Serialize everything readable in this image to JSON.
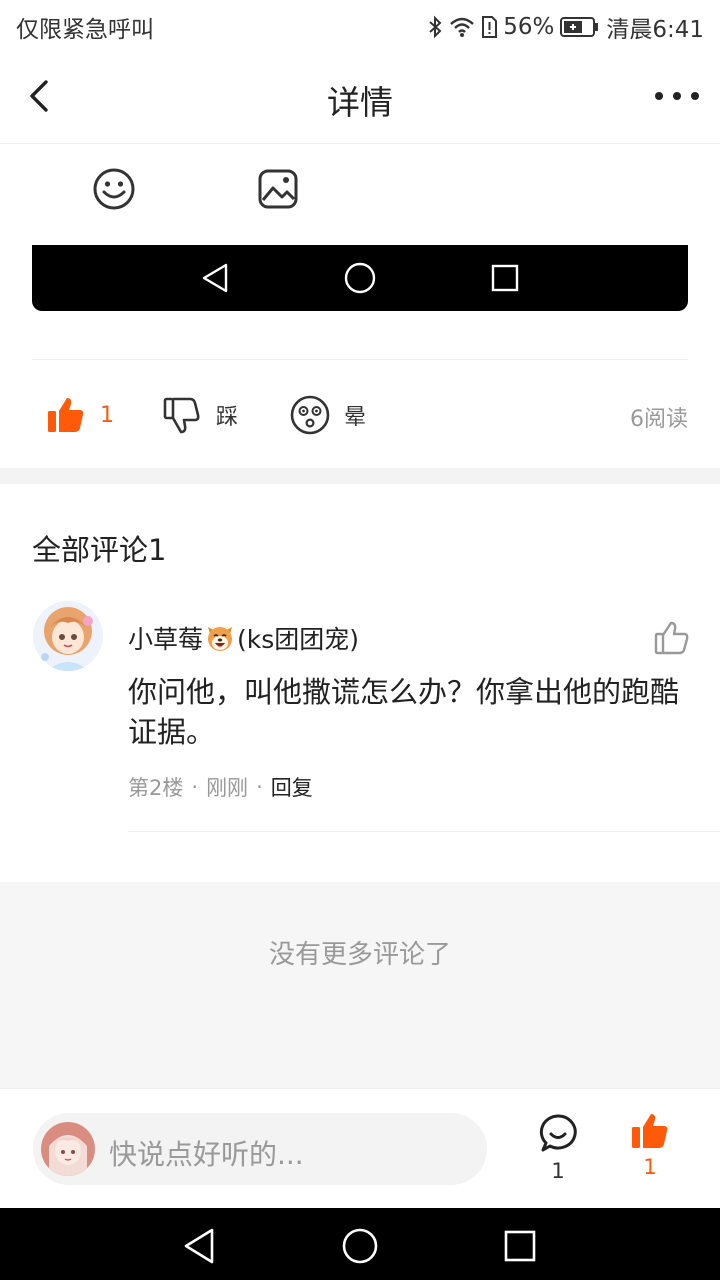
{
  "status_bar": {
    "carrier": "仅限紧急呼叫",
    "battery": "56%",
    "time": "清晨6:41"
  },
  "header": {
    "title": "详情"
  },
  "reactions": {
    "like_count": "1",
    "dislike_label": "踩",
    "dizzy_label": "晕",
    "read_count": "6阅读"
  },
  "comments": {
    "header": "全部评论1",
    "items": [
      {
        "user_prefix": "小草莓",
        "user_suffix": "(ks团团宠)",
        "text": "你问他，叫他撒谎怎么办？你拿出他的跑酷证据。",
        "floor": "第2楼",
        "time": "刚刚",
        "reply": "回复"
      }
    ],
    "no_more": "没有更多评论了"
  },
  "bottom_bar": {
    "input_placeholder": "快说点好听的...",
    "comment_count": "1",
    "like_count": "1"
  },
  "colors": {
    "accent": "#ff5a0a",
    "muted": "#999999"
  }
}
